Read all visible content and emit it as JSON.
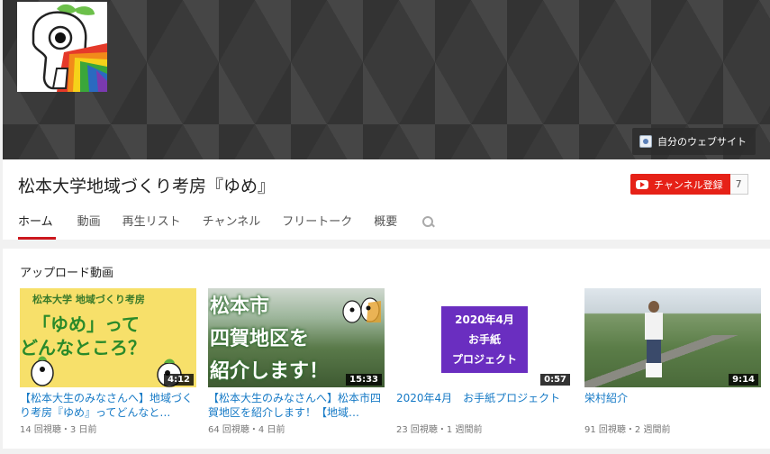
{
  "banner": {
    "site_link_label": "自分のウェブサイト"
  },
  "channel": {
    "title": "松本大学地域づくり考房『ゆめ』",
    "subscribe_label": "チャンネル登録",
    "subscriber_count": "7"
  },
  "tabs": [
    {
      "label": "ホーム",
      "active": true
    },
    {
      "label": "動画"
    },
    {
      "label": "再生リスト"
    },
    {
      "label": "チャンネル"
    },
    {
      "label": "フリートーク"
    },
    {
      "label": "概要"
    }
  ],
  "section": {
    "title": "アップロード動画"
  },
  "videos": [
    {
      "title": "【松本大生のみなさんへ】地域づくり考房『ゆめ』ってどんなと…",
      "meta": "14 回視聴・3 日前",
      "duration": "4:12",
      "thumb_text": {
        "top": "松本大学 地域づくり考房",
        "line1": "「ゆめ」って",
        "line2": "どんなところ？"
      }
    },
    {
      "title": "【松本大生のみなさんへ】松本市四賀地区を紹介します！【地域…",
      "meta": "64 回視聴・4 日前",
      "duration": "15:33",
      "thumb_text": {
        "line1": "松本市",
        "line2": "四賀地区を",
        "line3": "紹介します！"
      }
    },
    {
      "title": "2020年4月　お手紙プロジェクト",
      "meta": "23 回視聴・1 週間前",
      "duration": "0:57",
      "thumb_text": {
        "line1": "2020年4月",
        "line2": "お手紙",
        "line3": "プロジェクト"
      }
    },
    {
      "title": "栄村紹介",
      "meta": "91 回視聴・2 週間前",
      "duration": "9:14"
    }
  ]
}
